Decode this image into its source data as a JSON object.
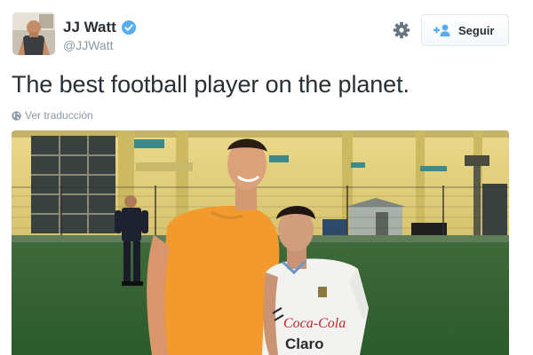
{
  "author": {
    "name": "JJ Watt",
    "handle": "@JJWatt",
    "avatar_icon": "profile-photo",
    "verified_icon": "verified-badge-icon"
  },
  "actions": {
    "follow_label": "Seguir",
    "follow_icon": "add-user-icon",
    "settings_icon": "gear-icon"
  },
  "tweet": {
    "text": "The best football player on the planet.",
    "translate_label": "Ver traducción",
    "translate_icon": "globe-icon"
  },
  "media": {
    "photo_sponsor_1": "Coca-Cola",
    "photo_sponsor_2": "Claro"
  },
  "colors": {
    "text": "#292f33",
    "muted": "#8899a6",
    "verified": "#55acee",
    "button_border": "#e1e8ed"
  }
}
